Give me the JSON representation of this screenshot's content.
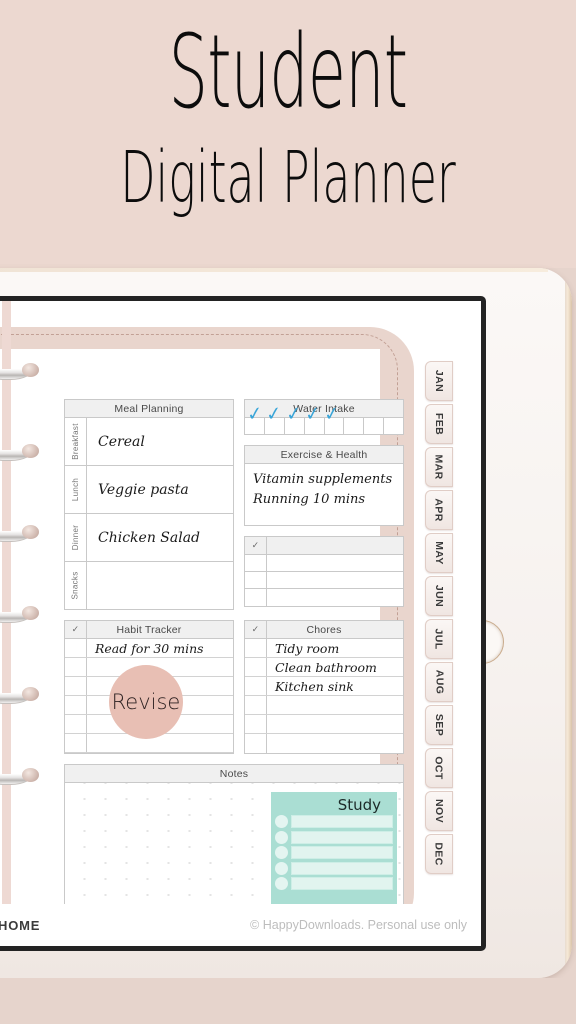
{
  "banner": {
    "title_main": "Student",
    "title_sub": "Digital Planner",
    "background_color": "#ecd8d0"
  },
  "device": {
    "type": "tablet",
    "bezel_color": "#f6f1ee",
    "screen_background": "#ffffff",
    "home_button": "home-button"
  },
  "planner": {
    "frame_color": "#e9d5cd",
    "dash_color": "#c2a095",
    "binder_ring_count": 6,
    "meal_planning": {
      "title": "Meal Planning",
      "rows": [
        {
          "label": "Breakfast",
          "value": "Cereal"
        },
        {
          "label": "Lunch",
          "value": "Veggie pasta"
        },
        {
          "label": "Dinner",
          "value": "Chicken Salad"
        },
        {
          "label": "Snacks",
          "value": ""
        }
      ]
    },
    "water_intake": {
      "title": "Water Intake",
      "total_cells": 8,
      "checked": 5,
      "check_color": "#3aa5d8",
      "check_glyph": "✓"
    },
    "exercise_health": {
      "title": "Exercise & Health",
      "lines": [
        "Vitamin supplements",
        "Running 10 mins"
      ]
    },
    "checklist": {
      "title": "",
      "check_glyph": "✓",
      "rows": [
        "",
        "",
        ""
      ]
    },
    "habit_tracker": {
      "title": "Habit Tracker",
      "check_glyph": "✓",
      "items": [
        "Read for 30 mins",
        "",
        "",
        "",
        "",
        ""
      ],
      "sticker": {
        "label": "Revise",
        "color": "#e8bfb4"
      }
    },
    "chores": {
      "title": "Chores",
      "check_glyph": "✓",
      "items": [
        "Tidy room",
        "Clean bathroom",
        "Kitchen sink",
        "",
        "",
        ""
      ]
    },
    "notes": {
      "title": "Notes",
      "sticker": {
        "label": "Study",
        "color": "#aaded3",
        "row_count": 5
      }
    },
    "month_tabs": [
      "JAN",
      "FEB",
      "MAR",
      "APR",
      "MAY",
      "JUN",
      "JUL",
      "AUG",
      "SEP",
      "OCT",
      "NOV",
      "DEC"
    ]
  },
  "footer": {
    "home_label": "HOME",
    "copyright": "© HappyDownloads. Personal use only"
  }
}
